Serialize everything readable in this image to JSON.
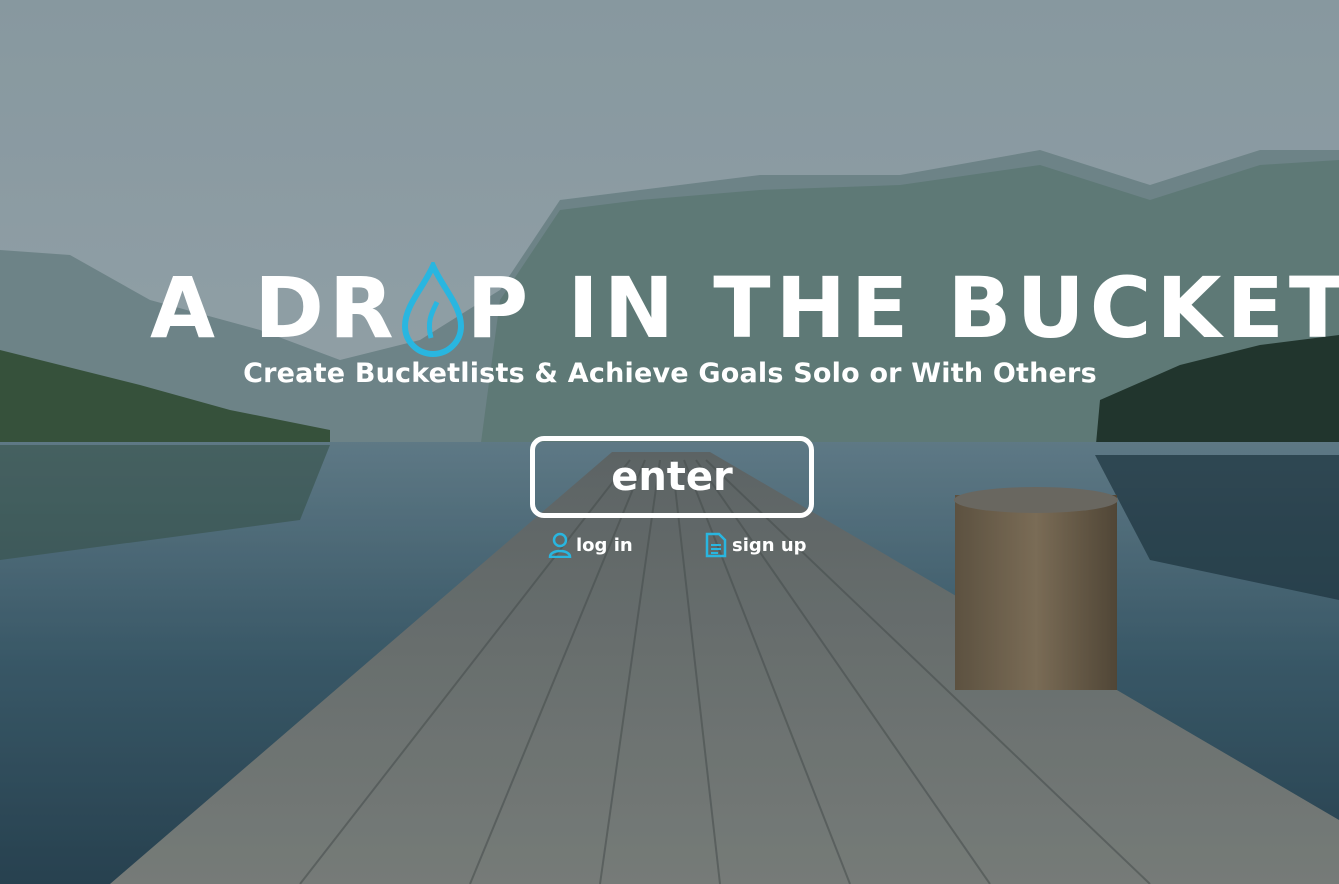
{
  "hero": {
    "title_part1": "A DR",
    "title_part2": "P IN THE BUCKET",
    "subtitle": "Create Bucketlists & Achieve Goals Solo or With Others",
    "enter_label": "enter"
  },
  "links": {
    "login_label": "log in",
    "signup_label": "sign up"
  },
  "icons": {
    "logo_drop": "water-drop-icon",
    "login": "user-icon",
    "signup": "document-icon"
  },
  "colors": {
    "accent": "#29b6e0",
    "text": "#ffffff"
  }
}
